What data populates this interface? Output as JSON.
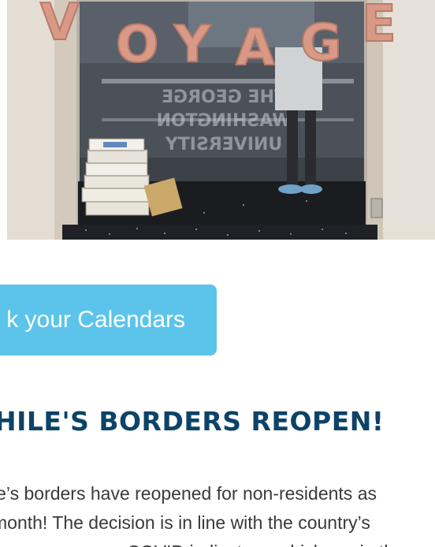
{
  "photo": {
    "balloon_letters": [
      "V",
      "O",
      "Y",
      "A",
      "G",
      "E"
    ],
    "glass_etching_lines": [
      "THE GEORGE",
      "WASHINGTON",
      "UNIVERSITY"
    ],
    "balloon_color": "#d89a86",
    "alt_description_icon": "photo-image"
  },
  "cta": {
    "label": "k your Calendars",
    "color": "#5cc4ea"
  },
  "headline": {
    "text": "HILE'S BORDERS REOPEN!",
    "color": "#0d4367"
  },
  "body": {
    "lines": [
      "le’s borders have reopened for non-residents as",
      " month! The decision is in line with the country’s",
      "                   s on COVID indicators, which are in the"
    ]
  }
}
